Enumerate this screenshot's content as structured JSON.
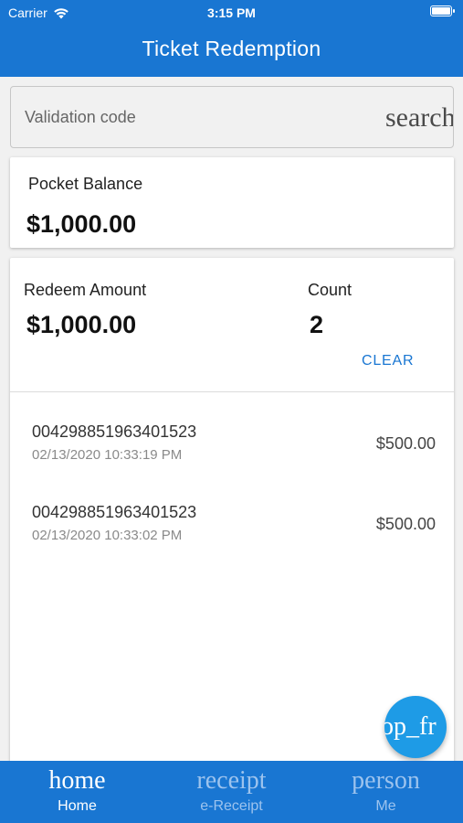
{
  "status_bar": {
    "carrier": "Carrier",
    "time": "3:15 PM"
  },
  "header": {
    "title": "Ticket Redemption"
  },
  "search": {
    "placeholder": "Validation code",
    "icon_text": "search",
    "icon": "search-icon"
  },
  "balance": {
    "label": "Pocket Balance",
    "value": "$1,000.00"
  },
  "redeem": {
    "amount_label": "Redeem Amount",
    "amount_value": "$1,000.00",
    "count_label": "Count",
    "count_value": "2",
    "clear_label": "CLEAR"
  },
  "tickets": [
    {
      "code": "004298851963401523",
      "date": "02/13/2020 10:33:19 PM",
      "amount": "$500.00"
    },
    {
      "code": "004298851963401523",
      "date": "02/13/2020 10:33:02 PM",
      "amount": "$500.00"
    }
  ],
  "fab": {
    "icon_text": "op_fr"
  },
  "bottom_nav": {
    "items": [
      {
        "icon_text": "home",
        "label": "Home",
        "active": true
      },
      {
        "icon_text": "receipt",
        "label": "e-Receipt",
        "active": false
      },
      {
        "icon_text": "person",
        "label": "Me",
        "active": false
      }
    ]
  },
  "colors": {
    "primary": "#1976d2",
    "fab": "#1e9be6",
    "background": "#f1f1f1",
    "inactive_nav": "#9cc3ee"
  }
}
